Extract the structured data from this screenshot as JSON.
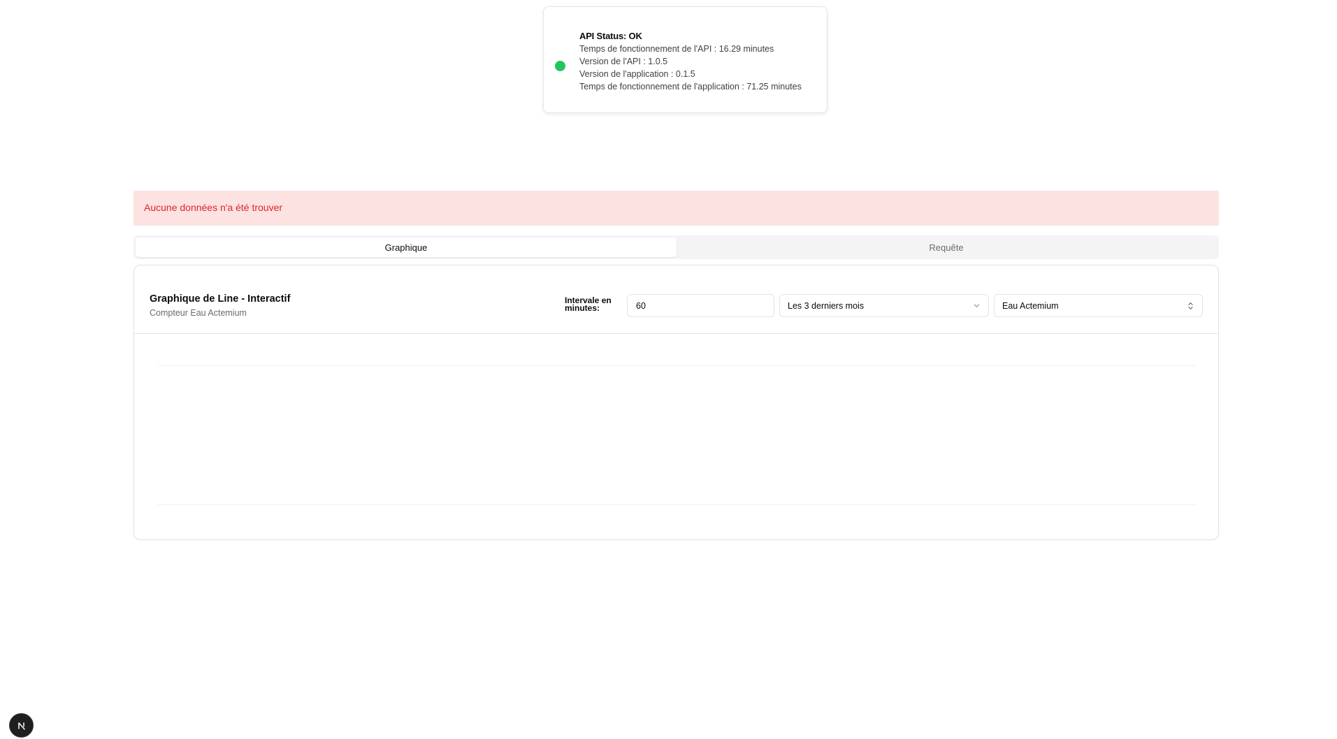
{
  "status": {
    "title": "API Status: OK",
    "lines": [
      "Temps de fonctionnement de l'API : 16.29 minutes",
      "Version de l'API : 1.0.5",
      "Version de l'application : 0.1.5",
      "Temps de fonctionnement de l'application : 71.25 minutes"
    ],
    "dot_color": "#22c55e"
  },
  "alert": {
    "message": "Aucune données n'a été trouver"
  },
  "tabs": [
    {
      "label": "Graphique",
      "active": true
    },
    {
      "label": "Requête",
      "active": false
    }
  ],
  "chart_card": {
    "title": "Graphique de Line - Interactif",
    "subtitle": "Compteur Eau Actemium",
    "interval_label": "Intervale en minutes:",
    "interval_value": "60",
    "range_select": {
      "value": "Les 3 derniers mois",
      "icon": "chevron-down-icon"
    },
    "sensor_select": {
      "value": "Eau Actemium",
      "icon": "chevron-up-down-icon"
    }
  },
  "badge": {
    "icon": "nextjs-logo-icon"
  }
}
